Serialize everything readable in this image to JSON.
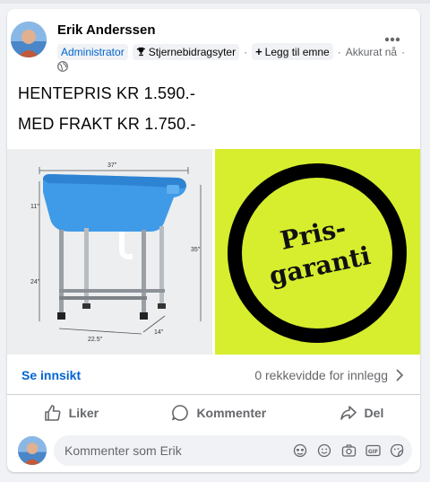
{
  "post": {
    "author": "Erik Anderssen",
    "role_badge": "Administrator",
    "contributor_badge": "Stjernebidragsyter",
    "topic_button": "Legg til emne",
    "timestamp": "Akkurat nå",
    "lines": [
      "HENTEPRIS KR 1.590.-",
      "MED FRAKT KR 1.750.-"
    ]
  },
  "photo_left": {
    "dims": {
      "width": "37\"",
      "tub_height": "11\"",
      "leg_height": "24\"",
      "total_height": "35\"",
      "depth": "22.5\"",
      "side": "14\""
    }
  },
  "photo_right": {
    "line1": "Pris-",
    "line2": "garanti",
    "bg_color": "#d6ee2e"
  },
  "insights": {
    "link": "Se innsikt",
    "reach": "0 rekkevidde for innlegg"
  },
  "actions": {
    "like": "Liker",
    "comment": "Kommenter",
    "share": "Del"
  },
  "comment_box": {
    "placeholder": "Kommenter som Erik"
  },
  "colors": {
    "accent": "#0064d1",
    "muted": "#65676b"
  }
}
